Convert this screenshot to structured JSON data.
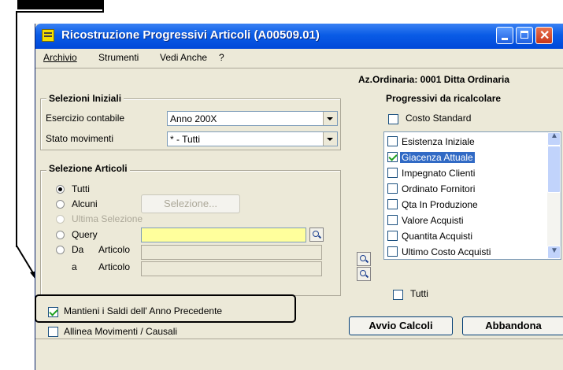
{
  "window": {
    "title": "Ricostruzione Progressivi Articoli (A00509.01)"
  },
  "menu": [
    "Archivio",
    "Strumenti",
    "Vedi Anche",
    "?"
  ],
  "company": "Az.Ordinaria: 0001 Ditta Ordinaria",
  "selezioni_iniziali": {
    "title": "Selezioni Iniziali",
    "esercizio_label": "Esercizio contabile",
    "esercizio_value": "Anno 200X",
    "stato_label": "Stato movimenti",
    "stato_value": "* - Tutti"
  },
  "selezione_articoli": {
    "title": "Selezione Articoli",
    "radio_tutti": "Tutti",
    "radio_alcuni": "Alcuni",
    "selezione_button": "Selezione...",
    "radio_ultima": "Ultima Selezione",
    "radio_query": "Query",
    "radio_da": "Da",
    "articolo_label": "Articolo",
    "a_label": "a",
    "articolo2_label": "Articolo"
  },
  "progressivi": {
    "title": "Progressivi da ricalcolare",
    "costo_standard": "Costo Standard",
    "items": [
      {
        "label": "Esistenza Iniziale",
        "checked": false
      },
      {
        "label": "Giacenza Attuale",
        "checked": true
      },
      {
        "label": "Impegnato Clienti",
        "checked": false
      },
      {
        "label": "Ordinato Fornitori",
        "checked": false
      },
      {
        "label": "Qta In Produzione",
        "checked": false
      },
      {
        "label": "Valore Acquisti",
        "checked": false
      },
      {
        "label": "Quantita Acquisti",
        "checked": false
      },
      {
        "label": "Ultimo Costo Acquisti",
        "checked": false
      }
    ],
    "tutti": "Tutti"
  },
  "options": {
    "mantieni": "Mantieni i Saldi dell' Anno Precedente",
    "allinea": "Allinea Movimenti / Causali"
  },
  "buttons": {
    "avvio": "Avvio Calcoli",
    "abbandona": "Abbandona"
  }
}
